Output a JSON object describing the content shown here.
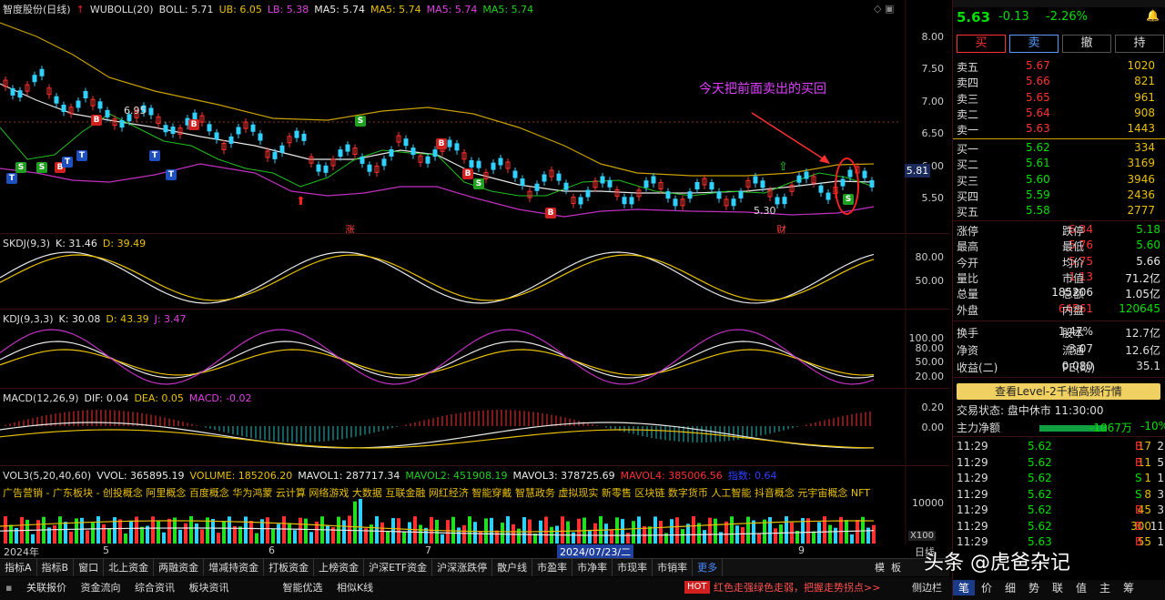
{
  "header": {
    "stock": "智度股份(日线)",
    "indicator": "WUBOLL(20)",
    "boll": "BOLL: 5.71",
    "ub": "UB: 6.05",
    "lb": "LB: 5.38",
    "ma5a": "MA5: 5.74",
    "ma5b": "MA5: 5.74",
    "ma5c": "MA5: 5.74",
    "ma5d": "MA5: 5.74"
  },
  "price_axis": [
    "8.00",
    "7.50",
    "7.00",
    "6.50",
    "6.00",
    "5.50"
  ],
  "current_price_tag": "5.81",
  "annotations": {
    "high": "6.95",
    "low": "5.30",
    "note": "今天把前面卖出的买回",
    "zhang": "涨",
    "cai": "财"
  },
  "skdj": {
    "name": "SKDJ(9,3)",
    "k": "K: 31.46",
    "d": "D: 39.49",
    "axis": [
      "80.00",
      "50.00"
    ]
  },
  "kdj": {
    "name": "KDJ(9,3,3)",
    "k": "K: 30.08",
    "d": "D: 43.39",
    "j": "J: 3.47",
    "axis": [
      "100.00",
      "80.00",
      "50.00",
      "20.00"
    ]
  },
  "macd": {
    "name": "MACD(12,26,9)",
    "dif": "DIF: 0.04",
    "dea": "DEA: 0.05",
    "macd": "MACD: -0.02",
    "axis": [
      "0.20",
      "0.00"
    ]
  },
  "vol": {
    "name": "VOL3(5,20,40,60)",
    "vvol": "VVOL: 365895.19",
    "volume": "VOLUME: 185206.20",
    "mavol1": "MAVOL1: 287717.34",
    "mavol2": "MAVOL2: 451908.19",
    "mavol3": "MAVOL3: 378725.69",
    "mavol4": "MAVOL4: 385006.56",
    "ind": "指数: 0.64",
    "axis": "10000",
    "unit": "X100"
  },
  "concepts": "广告营销 - 广东板块 - 创投概念 阿里概念 百度概念 华为鸿蒙 云计算 网络游戏 大数据 互联金融 网红经济 智能穿戴 智慧政务 虚拟现实 新零售 区块链 数字货币 人工智能 抖音概念 元宇宙概念 NFT",
  "timeline": {
    "y2024": "2024年",
    "m5": "5",
    "m6": "6",
    "m7": "7",
    "cursor": "2024/07/23/二",
    "m9": "9",
    "right": "日线"
  },
  "bottom_tabs": [
    "指标A",
    "指标B",
    "窗口",
    "北上资金",
    "两融资金",
    "增减持资金",
    "打板资金",
    "上榜资金",
    "沪深ETF资金",
    "沪深涨跌停",
    "散户线",
    "市盈率",
    "市净率",
    "市现率",
    "市销率",
    "更多"
  ],
  "bottom_tabs_right": [
    "模",
    "板"
  ],
  "bottom_bar": [
    "关联报价",
    "资金流向",
    "综合资讯",
    "板块资讯",
    "",
    "智能优选",
    "相似K线"
  ],
  "hot": {
    "tag": "HOT",
    "text": "红色走强绿色走弱，把握走势拐点>>"
  },
  "side_tabs": [
    "侧边栏",
    "笔",
    "价",
    "细",
    "势",
    "联",
    "值",
    "主",
    "筹"
  ],
  "watermark": "头条 @虎爸杂记",
  "quote": {
    "price": "5.63",
    "chg": "-0.13",
    "pct": "-2.26%"
  },
  "trade_buttons": [
    "买",
    "卖",
    "撤",
    "持"
  ],
  "asks": [
    [
      "卖五",
      "5.67",
      "1020"
    ],
    [
      "卖四",
      "5.66",
      "821"
    ],
    [
      "卖三",
      "5.65",
      "961"
    ],
    [
      "卖二",
      "5.64",
      "908"
    ],
    [
      "卖一",
      "5.63",
      "1443"
    ]
  ],
  "bids": [
    [
      "买一",
      "5.62",
      "334"
    ],
    [
      "买二",
      "5.61",
      "3169"
    ],
    [
      "买三",
      "5.60",
      "3946"
    ],
    [
      "买四",
      "5.59",
      "2436"
    ],
    [
      "买五",
      "5.58",
      "2777"
    ]
  ],
  "stats": [
    [
      [
        "涨停",
        "6.34",
        "red"
      ],
      [
        "跌停",
        "5.18",
        "green"
      ]
    ],
    [
      [
        "最高",
        "5.76",
        "red"
      ],
      [
        "最低",
        "5.60",
        "green"
      ]
    ],
    [
      [
        "今开",
        "5.75",
        "red"
      ],
      [
        "均价",
        "5.66",
        "white"
      ]
    ],
    [
      [
        "量比",
        "1.13",
        "red"
      ],
      [
        "市值",
        "71.2亿",
        "white"
      ]
    ],
    [
      [
        "总量",
        "185206",
        "white"
      ],
      [
        "总额",
        "1.05亿",
        "white"
      ]
    ],
    [
      [
        "外盘",
        "64561",
        "red"
      ],
      [
        "内盘",
        "120645",
        "green"
      ]
    ]
  ],
  "stats2": [
    [
      [
        "换手",
        "1.47%"
      ],
      [
        "股本",
        "12.7亿"
      ]
    ],
    [
      [
        "净资",
        "3.07"
      ],
      [
        "流通",
        "12.6亿"
      ]
    ],
    [
      [
        "收益(二)",
        "0.080"
      ],
      [
        "PE(动)",
        "35.1"
      ]
    ]
  ],
  "level2": "查看Level-2千档高频行情",
  "status": "交易状态: 盘中休市 11:30:00",
  "net": {
    "label": "主力净额",
    "value": "-1067万",
    "pct": "-10%"
  },
  "ticks": [
    [
      "11:29",
      "5.62",
      "17",
      "B",
      "2"
    ],
    [
      "11:29",
      "5.62",
      "11",
      "B",
      "5"
    ],
    [
      "11:29",
      "5.62",
      "1",
      "S",
      "1"
    ],
    [
      "11:29",
      "5.62",
      "8",
      "S",
      "3"
    ],
    [
      "11:29",
      "5.62",
      "45",
      "B",
      "3"
    ],
    [
      "11:29",
      "5.62",
      "300",
      "B",
      "11"
    ],
    [
      "11:29",
      "5.63",
      "55",
      "B",
      "1"
    ]
  ],
  "chart_data": {
    "type": "line",
    "title": "智度股份(日线)",
    "series": [
      {
        "name": "BOLL",
        "values": [
          5.71
        ]
      },
      {
        "name": "UB",
        "values": [
          6.05
        ]
      },
      {
        "name": "LB",
        "values": [
          5.38
        ]
      }
    ]
  }
}
